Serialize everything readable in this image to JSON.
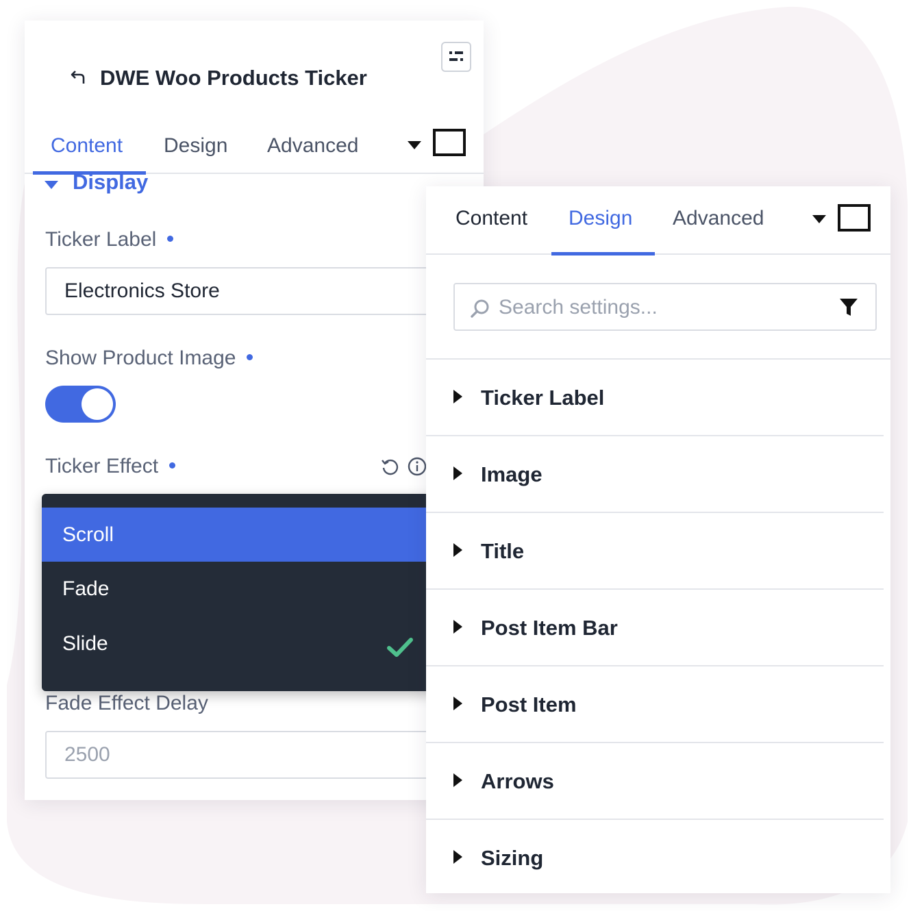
{
  "colors": {
    "accent": "#4169e1",
    "dropdown_bg": "#242c38",
    "check_green": "#4fc08d",
    "blob": "#f8f3f6"
  },
  "left_panel": {
    "title": "DWE Woo Products Ticker",
    "back_icon": "undo-arrow-icon",
    "menu_icon": "menu-dots-icon",
    "tabs": [
      {
        "label": "Content",
        "active": true
      },
      {
        "label": "Design",
        "active": false
      },
      {
        "label": "Advanced",
        "active": false
      }
    ],
    "section": {
      "title": "Display"
    },
    "fields": {
      "ticker_label": {
        "label": "Ticker Label",
        "value": "Electronics Store"
      },
      "show_product_image": {
        "label": "Show Product Image",
        "on": true
      },
      "ticker_effect": {
        "label": "Ticker Effect",
        "options": [
          {
            "label": "Scroll",
            "highlighted": true
          },
          {
            "label": "Fade",
            "highlighted": false
          },
          {
            "label": "Slide",
            "checked": true
          }
        ]
      },
      "fade_effect_delay": {
        "label": "Fade Effect Delay",
        "placeholder": "2500"
      }
    }
  },
  "right_panel": {
    "tabs": [
      {
        "label": "Content",
        "active": false
      },
      {
        "label": "Design",
        "active": true
      },
      {
        "label": "Advanced",
        "active": false
      }
    ],
    "search": {
      "placeholder": "Search settings..."
    },
    "sections": [
      "Ticker Label",
      "Image",
      "Title",
      "Post Item Bar",
      "Post Item",
      "Arrows",
      "Sizing"
    ]
  }
}
